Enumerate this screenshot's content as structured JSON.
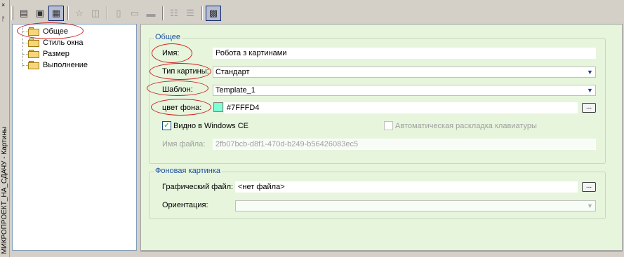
{
  "window": {
    "close_glyph": "×",
    "pin_glyph": "ᚠ",
    "vertical_title": "МИКРОПРОЕКТ_НА_СДАЧУ - Картины"
  },
  "toolbar": {
    "icons": [
      "properties-icon",
      "document-icon",
      "form-view-icon",
      "favorite-star-icon",
      "copy-form-icon",
      "align-left-icon",
      "field-icon",
      "button-icon",
      "group-vertical-icon",
      "group-list-icon",
      "palette-icon"
    ]
  },
  "tree": {
    "items": [
      {
        "label": "Общее",
        "icon": "folder-icon",
        "selected": true
      },
      {
        "label": "Стиль окна",
        "icon": "folder-icon"
      },
      {
        "label": "Размер",
        "icon": "folder-icon"
      },
      {
        "label": "Выполнение",
        "icon": "folder-icon"
      }
    ]
  },
  "general": {
    "group_title": "Общее",
    "name_label": "Имя:",
    "name_value": "Робота з картинами",
    "type_label": "Тип картины:",
    "type_value": "Стандарт",
    "template_label": "Шаблон:",
    "template_value": "Template_1",
    "bgcolor_label": "цвет фона:",
    "bgcolor_value": "#7FFFD4",
    "bgcolor_swatch": "#7FFFD4",
    "browse_label": "...",
    "visible_wince_label": "Видно в Windows CE",
    "visible_wince_checked": true,
    "auto_keyboard_label": "Автоматическая раскладка клавиатуры",
    "auto_keyboard_checked": false,
    "filename_label": "Имя файла:",
    "filename_value": "2fb07bcb-d8f1-470d-b249-b56426083ec5"
  },
  "background": {
    "group_title": "Фоновая картинка",
    "file_label": "Графический файл:",
    "file_value": "<нет файла>",
    "browse_label": "...",
    "orientation_label": "Ориентация:",
    "orientation_value": ""
  },
  "colors": {
    "panel_bg": "#e6f5dc",
    "group_title": "#1e4fa0",
    "highlight_ellipse": "#cc2020"
  }
}
